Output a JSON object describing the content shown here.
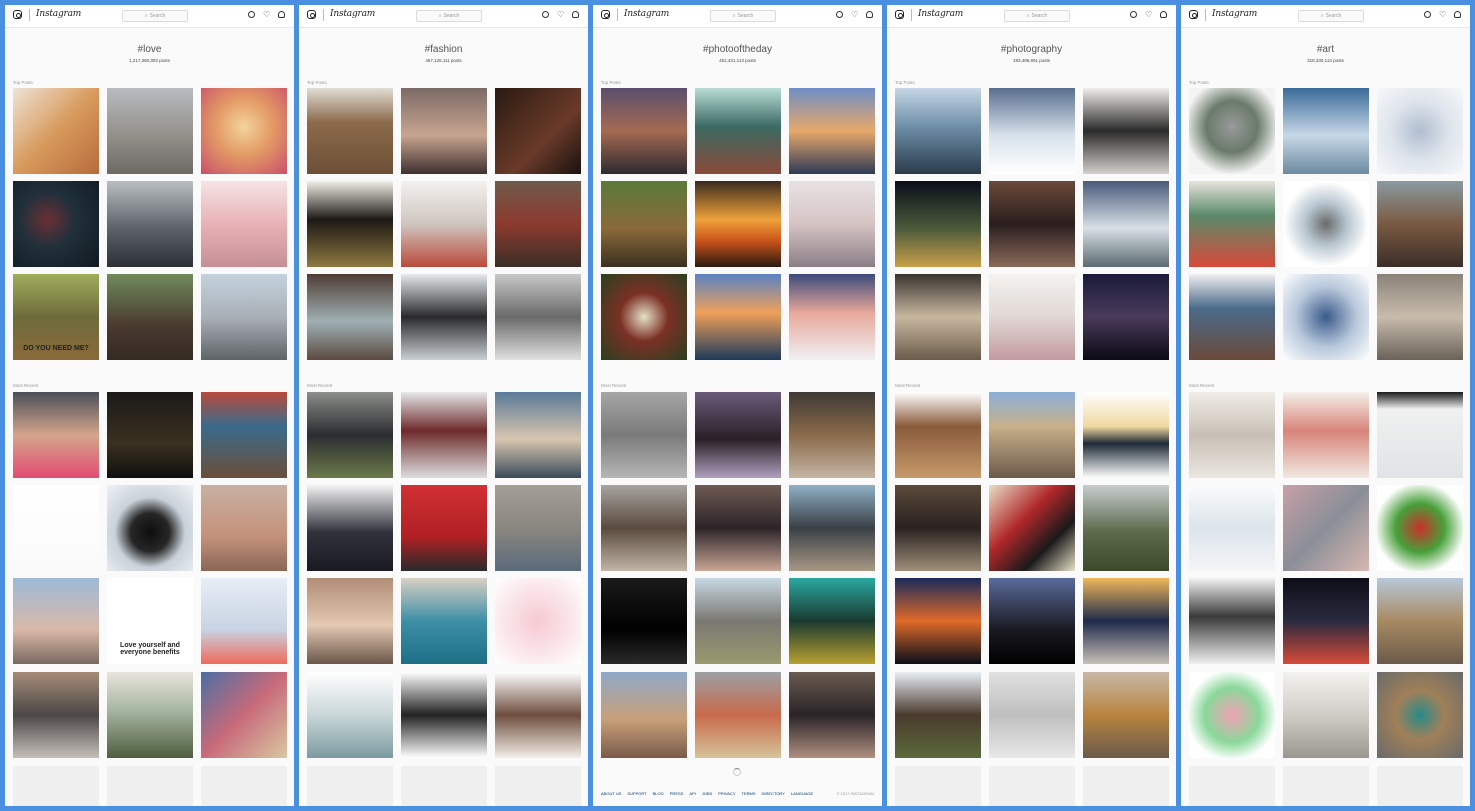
{
  "app": {
    "logo": "Instagram",
    "search_placeholder": "Search",
    "heart": "♡"
  },
  "sections": {
    "top": "Top Posts",
    "recent": "Most Recent"
  },
  "panels": [
    {
      "hashtag": "#love",
      "count": "1,217,360,303 posts",
      "top": [
        {
          "c": "#c98a5a",
          "g": "linear-gradient(135deg,#efe4d8 0%,#d89a5d 50%,#b76b3c 100%)"
        },
        {
          "c": "#9aa3a8",
          "g": "linear-gradient(180deg,#b8bcbf 0%,#8f8c86 60%,#6d6a66 100%)"
        },
        {
          "c": "#e0a86d",
          "g": "radial-gradient(circle at 50% 45%,#f4d39c 0%,#e39a65 45%,#c94f6a 100%)"
        },
        {
          "c": "#1f2b33",
          "g": "radial-gradient(circle at 40% 45%,#6a3035 0%,#20303b 40%,#111920 100%)"
        },
        {
          "c": "#60666d",
          "g": "linear-gradient(180deg,#b9bec2 0%,#5c6268 55%,#2c3036 100%)"
        },
        {
          "c": "#e7b8bd",
          "g": "linear-gradient(180deg,#f6e3e4 0%,#e8b2b6 50%,#c58f96 100%)"
        },
        {
          "c": "#6a7a42",
          "g": "linear-gradient(180deg,#9fae5c 0%,#6d6b3a 50%,#8a6a3a 100%)",
          "ov": "DO YOU NEED ME?"
        },
        {
          "c": "#3d4a36",
          "g": "linear-gradient(180deg,#6f8b5a 0%,#4a3a30 60%,#352a24 100%)"
        },
        {
          "c": "#9aa2a8",
          "g": "linear-gradient(180deg,#c4d2de 0%,#a9b0b6 50%,#5f6368 100%)"
        }
      ],
      "recent": [
        {
          "c": "#c6a290",
          "g": "linear-gradient(180deg,#4b4f58 0%,#d4a58c 50%,#e34c73 100%)"
        },
        {
          "c": "#1a1a1a",
          "g": "linear-gradient(180deg,#1a1a1a 0%,#3b3020 60%,#0f0f0f 100%)"
        },
        {
          "c": "#8a4b3e",
          "g": "linear-gradient(180deg,#b84a3c 0%,#3a6b8a 40%,#6a4e3a 100%)"
        },
        {
          "c": "#ffffff",
          "g": "linear-gradient(180deg,#ffffff 0%,#fafafa 100%)",
          "ov": ""
        },
        {
          "c": "#cfd7df",
          "g": "radial-gradient(circle at 50% 55%,#0e0e0e 0%,#262626 30%,#c9d2da 55%,#eef2f5 100%)"
        },
        {
          "c": "#c79c86",
          "g": "linear-gradient(180deg,#c8b0a4 0%,#c4927a 60%,#8a6656 100%)"
        },
        {
          "c": "#a2b7d0",
          "g": "linear-gradient(180deg,#9db9d8 0%,#d9b9a8 60%,#7a6960 100%)"
        },
        {
          "c": "#ffffff",
          "g": "linear-gradient(180deg,#ffffff 0%,#ffffff 100%)",
          "ov": "Love yourself and everyone benefits"
        },
        {
          "c": "#e0e6ef",
          "g": "linear-gradient(180deg,#e8eef6 0%,#c8d3e3 60%,#ef6a5a 100%)"
        },
        {
          "c": "#7a6e66",
          "g": "linear-gradient(180deg,#a58c78 0%,#4c4848 50%,#c6c0ba 100%)"
        },
        {
          "c": "#6d8a5a",
          "g": "linear-gradient(180deg,#e8e4dc 0%,#a6b5a0 45%,#4e5e3e 100%)"
        },
        {
          "c": "#8a5e74",
          "g": "linear-gradient(135deg,#4b6fa3 0%,#c86a7a 50%,#d9c8a2 100%)"
        }
      ]
    },
    {
      "hashtag": "#fashion",
      "count": "457,126,111 posts",
      "top": [
        {
          "c": "#8a6a4a",
          "g": "linear-gradient(180deg,#e0ddd4 0%,#8c6a4c 40%,#6d4f36 100%)"
        },
        {
          "c": "#5c4a42",
          "g": "linear-gradient(180deg,#7c6a66 0%,#c8a590 55%,#3d3030 100%)"
        },
        {
          "c": "#3a2418",
          "g": "linear-gradient(135deg,#2a1a12 0%,#6a3a28 60%,#1a1210 100%)"
        },
        {
          "c": "#2c2418",
          "g": "linear-gradient(180deg,#f2efe8 0%,#1c1814 45%,#8f7a42 100%)"
        },
        {
          "c": "#cfc9c4",
          "g": "linear-gradient(180deg,#f3f1ee 0%,#cfc5c0 50%,#b94a3a 100%)"
        },
        {
          "c": "#5a4638",
          "g": "linear-gradient(180deg,#6e5a4c 0%,#8c3a2e 50%,#3a2e26 100%)"
        },
        {
          "c": "#6b5247",
          "g": "linear-gradient(180deg,#4f3d34 0%,#9fb0b3 55%,#5b4a40 100%)"
        },
        {
          "c": "#d6dce1",
          "g": "linear-gradient(180deg,#e6eaed 0%,#2a2a2c 50%,#c9cfd3 100%)"
        },
        {
          "c": "#8a8a8a",
          "g": "linear-gradient(180deg,#c8c8c8 0%,#6a6a6a 50%,#e0e0e0 100%)"
        }
      ],
      "recent": [
        {
          "c": "#4a4a3a",
          "g": "linear-gradient(180deg,#8c8e8a 0%,#2a2c30 50%,#6b7a4a 100%)"
        },
        {
          "c": "#6a2a28",
          "g": "linear-gradient(180deg,#e6e8ea 0%,#6e2a2a 45%,#dcdee0 100%)"
        },
        {
          "c": "#6f8fa8",
          "g": "linear-gradient(180deg,#5a7a98 0%,#d9c6b0 55%,#3a4a5a 100%)"
        },
        {
          "c": "#2a2c36",
          "g": "linear-gradient(180deg,#f4f4f4 0%,#30323c 55%,#1a1a22 100%)"
        },
        {
          "c": "#c42a2e",
          "g": "linear-gradient(180deg,#d23034 0%,#b02024 60%,#2a2a2a 100%)"
        },
        {
          "c": "#7e7a72",
          "g": "linear-gradient(180deg,#a39e96 0%,#8a8780 50%,#5a6a7a 100%)"
        },
        {
          "c": "#c8a994",
          "g": "linear-gradient(180deg,#b08d76 0%,#e4c9b3 55%,#6a564a 100%)"
        },
        {
          "c": "#5a8ca0",
          "g": "linear-gradient(180deg,#d8d0c4 0%,#3e8fa6 50%,#1c6f86 100%)"
        },
        {
          "c": "#f1d8dd",
          "g": "radial-gradient(circle at 50% 50%,#f6c9d2 0%,#fbe9ec 60%,#ffffff 100%)"
        },
        {
          "c": "#aebec4",
          "g": "linear-gradient(180deg,#ffffff 0%,#c9d6d8 50%,#7c9aa0 100%)"
        },
        {
          "c": "#1e1e1e",
          "g": "linear-gradient(180deg,#ffffff 0%,#222222 50%,#ffffff 100%)"
        },
        {
          "c": "#6a4a3a",
          "g": "linear-gradient(180deg,#ffffff 0%,#6e4d3e 50%,#f4efe8 100%)"
        }
      ]
    },
    {
      "hashtag": "#photooftheday",
      "count": "452,431,113 posts",
      "top": [
        {
          "c": "#5a4a58",
          "g": "linear-gradient(180deg,#5a4e6c 0%,#a56a52 50%,#2e2a30 100%)"
        },
        {
          "c": "#3e6a5a",
          "g": "linear-gradient(180deg,#b9dcd6 0%,#3a6a62 45%,#8a4a3a 100%)"
        },
        {
          "c": "#6a7ea8",
          "g": "linear-gradient(180deg,#6e8fc6 0%,#e8a86a 50%,#2e3a56 100%)"
        },
        {
          "c": "#4a5a30",
          "g": "linear-gradient(180deg,#5a7a3a 0%,#8a6a3a 55%,#3a3020 100%)"
        },
        {
          "c": "#c86a22",
          "g": "linear-gradient(180deg,#3a2a20 0%,#f0a23a 45%,#c8521a 70%,#2a1a10 100%)"
        },
        {
          "c": "#d0c8c8",
          "g": "linear-gradient(180deg,#e8e2e4 0%,#d6c4c4 50%,#8a7e86 100%)"
        },
        {
          "c": "#6a3a2a",
          "g": "radial-gradient(circle at 50% 50%,#e6e0c8 0%,#7a3024 40%,#2a4020 100%)"
        },
        {
          "c": "#4a6a9a",
          "g": "linear-gradient(180deg,#5a82c4 0%,#f0a05a 45%,#1e3a5a 100%)"
        },
        {
          "c": "#b8a4b8",
          "g": "linear-gradient(180deg,#3a4a7a 0%,#e8a89a 45%,#f0f0f4 100%)"
        }
      ],
      "recent": [
        {
          "c": "#8a8a8a",
          "g": "linear-gradient(180deg,#a6a6a6 0%,#7a7a7a 50%,#b6b6b6 100%)"
        },
        {
          "c": "#3a2a3a",
          "g": "linear-gradient(180deg,#6a5a7a 0%,#2a2026 55%,#b0a0c0 100%)"
        },
        {
          "c": "#6a5a4a",
          "g": "linear-gradient(180deg,#3e3a36 0%,#8a6a4a 50%,#c4b6a4 100%)"
        },
        {
          "c": "#7a6a5a",
          "g": "linear-gradient(180deg,#a8a4a0 0%,#5a4a3e 50%,#c2b6a8 100%)"
        },
        {
          "c": "#4a3a36",
          "g": "linear-gradient(180deg,#6e5a52 0%,#2c2428 50%,#c8a696 100%)"
        },
        {
          "c": "#6e7a80",
          "g": "linear-gradient(180deg,#8fb0c6 0%,#3a4046 50%,#a89884 100%)"
        },
        {
          "c": "#050505",
          "g": "linear-gradient(180deg,#1a1a1a 0%,#000000 60%,#2a2a2a 100%)"
        },
        {
          "c": "#8a8a7a",
          "g": "linear-gradient(180deg,#c8d8e2 0%,#7a7872 50%,#9a9a6e 100%)"
        },
        {
          "c": "#1e6a5a",
          "g": "linear-gradient(180deg,#2aa8a0 0%,#1a3a30 50%,#b8a030 100%)"
        },
        {
          "c": "#8a7a6a",
          "g": "linear-gradient(180deg,#8fa8c8 0%,#c8a078 55%,#7a5a4a 100%)"
        },
        {
          "c": "#a89a82",
          "g": "linear-gradient(180deg,#9ca0a4 0%,#c86a4a 50%,#d6c49a 100%)"
        },
        {
          "c": "#3a3030",
          "g": "linear-gradient(180deg,#6a5a50 0%,#2a2428 50%,#b09080 100%)"
        }
      ],
      "footer": [
        "ABOUT US",
        "SUPPORT",
        "BLOG",
        "PRESS",
        "API",
        "JOBS",
        "PRIVACY",
        "TERMS",
        "DIRECTORY",
        "LANGUAGE"
      ],
      "copyright": "© 2017 INSTAGRAM"
    },
    {
      "hashtag": "#photography",
      "count": "193,486,891 posts",
      "top": [
        {
          "c": "#6a8aa8",
          "g": "linear-gradient(180deg,#c6d6e6 0%,#6e8ea8 45%,#2a3a4a 100%)"
        },
        {
          "c": "#8aa0b8",
          "g": "linear-gradient(180deg,#5a6e8e 0%,#d8e2ec 55%,#ffffff 100%)"
        },
        {
          "c": "#d8d4d0",
          "g": "linear-gradient(180deg,#f0eeea 0%,#2a2a2a 50%,#d4d0cc 100%)"
        },
        {
          "c": "#1a1e2a",
          "g": "linear-gradient(180deg,#0a0e1a 0%,#4a5a3a 55%,#c8a04a 100%)"
        },
        {
          "c": "#3a2a2a",
          "g": "linear-gradient(180deg,#6a4a3a 0%,#2a1e1e 50%,#8a6a5a 100%)"
        },
        {
          "c": "#7a8a9a",
          "g": "linear-gradient(180deg,#4a5a7a 0%,#d8e0e6 55%,#5a6a70 100%)"
        },
        {
          "c": "#8a7a6a",
          "g": "linear-gradient(180deg,#3a3430 0%,#c8b8a0 50%,#6a5a4a 100%)"
        },
        {
          "c": "#e8e4e0",
          "g": "linear-gradient(180deg,#f4f2f0 0%,#e0d8d4 50%,#c49aa0 100%)"
        },
        {
          "c": "#2a2a4a",
          "g": "linear-gradient(180deg,#1a1a3a 0%,#4a3a5a 50%,#0a0a14 100%)"
        }
      ],
      "recent": [
        {
          "c": "#a06a3a",
          "g": "linear-gradient(180deg,#ffffff 0%,#8a5a3a 40%,#c69a6a 100%)"
        },
        {
          "c": "#8a7a5a",
          "g": "linear-gradient(180deg,#8ab0d8 0%,#c8b08a 40%,#6a5a4a 100%)"
        },
        {
          "c": "#e8c87a",
          "g": "linear-gradient(180deg,#ffffff 0%,#f0d8a0 40%,#1e2a36 60%,#ffffff 100%)"
        },
        {
          "c": "#4a3a2a",
          "g": "linear-gradient(180deg,#5a4a3a 0%,#2a2220 50%,#a0907a 100%)"
        },
        {
          "c": "#a0302a",
          "g": "linear-gradient(135deg,#e8e0c8 0%,#b0282a 40%,#1a1a1a 70%,#e8e0c8 100%)"
        },
        {
          "c": "#6a7a5a",
          "g": "linear-gradient(180deg,#c8ccce 0%,#5a6a4a 55%,#3a4a2a 100%)"
        },
        {
          "c": "#2a3a6a",
          "g": "linear-gradient(180deg,#1a2a5a 0%,#e06a2a 50%,#0a0e1a 100%)"
        },
        {
          "c": "#1a1e2a",
          "g": "linear-gradient(180deg,#5a6a9a 0%,#1a1a22 60%,#000000 100%)"
        },
        {
          "c": "#d8a04a",
          "g": "linear-gradient(180deg,#f0b85a 0%,#1e2a4a 50%,#c8c0b8 100%)"
        },
        {
          "c": "#6a5a4a",
          "g": "linear-gradient(180deg,#e8eef4 0%,#4a3a2e 50%,#5a6a3a 100%)"
        },
        {
          "c": "#d8d8d8",
          "g": "linear-gradient(180deg,#e0e0e0 0%,#bfbfbf 50%,#e8e8e8 100%)"
        },
        {
          "c": "#b88a5a",
          "g": "linear-gradient(180deg,#c8b8a8 0%,#b8843e 50%,#6a5a4a 100%)"
        }
      ]
    },
    {
      "hashtag": "#art",
      "count": "318,330,113 posts",
      "top": [
        {
          "c": "#8a8a8a",
          "g": "radial-gradient(circle at 50% 45%,#9a9a9a 0%,#6a7a6a 40%,#f4f4f4 75%)"
        },
        {
          "c": "#4a7aa8",
          "g": "linear-gradient(180deg,#3a6a98 0%,#c8d8e8 55%,#6a8aa0 100%)"
        },
        {
          "c": "#c0cad8",
          "g": "radial-gradient(circle at 50% 50%,#b0bed0 0%,#dfe5ec 50%,#f6f8fa 100%)"
        },
        {
          "c": "#6a8a5a",
          "g": "linear-gradient(180deg,#e8e4dc 0%,#5a8a6a 40%,#d84a3a 100%)"
        },
        {
          "c": "#a8b8c4",
          "g": "radial-gradient(circle at 50% 50%,#6a6a6a 0%,#b8c6d0 35%,#ffffff 70%)"
        },
        {
          "c": "#6a4a3a",
          "g": "linear-gradient(180deg,#8a9aa0 0%,#7a5a42 50%,#3a2e28 100%)"
        },
        {
          "c": "#5a4a3a",
          "g": "linear-gradient(180deg,#f0f0f0 0%,#4a6a8a 40%,#6a4a3a 100%)"
        },
        {
          "c": "#5a7aa0",
          "g": "radial-gradient(circle at 50% 50%,#3a5a8a 0%,#b8c8dc 50%,#ffffff 100%)"
        },
        {
          "c": "#a0968a",
          "g": "linear-gradient(180deg,#8a8278 0%,#c8bcac 50%,#6a6258 100%)"
        }
      ],
      "recent": [
        {
          "c": "#e0dcd6",
          "g": "linear-gradient(180deg,#f0ece6 0%,#c8c0b6 50%,#eae6e0 100%)"
        },
        {
          "c": "#c86a6a",
          "g": "linear-gradient(180deg,#f4f0ea 0%,#d8847a 45%,#f0e8e0 100%)"
        },
        {
          "c": "#e0e0e0",
          "g": "linear-gradient(180deg,#1a1a1a 0%,#f0f0f0 20%,#e0e4e6 100%)"
        },
        {
          "c": "#e8ecf0",
          "g": "linear-gradient(180deg,#fafcfd 0%,#dce4ea 50%,#f4f6f8 100%)"
        },
        {
          "c": "#a88c9a",
          "g": "linear-gradient(135deg,#c8a0a6 0%,#8a8e98 50%,#d8b8b0 100%)"
        },
        {
          "c": "#4a8a3a",
          "g": "radial-gradient(circle at 50% 50%,#c8302a 0%,#48a03a 40%,#ffffff 75%)"
        },
        {
          "c": "#eaeaea",
          "g": "linear-gradient(180deg,#f4f4f4 0%,#3a3a3a 45%,#f0f0f0 100%)"
        },
        {
          "c": "#1a1a2a",
          "g": "linear-gradient(180deg,#0e0e18 0%,#2a2a3e 50%,#d84a3a 100%)"
        },
        {
          "c": "#a08a6a",
          "g": "linear-gradient(180deg,#b8c8d8 0%,#a88a62 50%,#6a5a4a 100%)"
        },
        {
          "c": "#f08aa0",
          "g": "radial-gradient(circle at 50% 50%,#f0a0b4 0%,#8ad89a 45%,#ffffff 75%)"
        },
        {
          "c": "#e0ddd8",
          "g": "linear-gradient(180deg,#f4f2ee 0%,#d0ccc6 50%,#9a9690 100%)"
        },
        {
          "c": "#8a6a4a",
          "g": "radial-gradient(circle at 50% 50%,#2a8a8a 0%,#a08058 40%,#6a6a6a 100%)"
        }
      ]
    }
  ]
}
